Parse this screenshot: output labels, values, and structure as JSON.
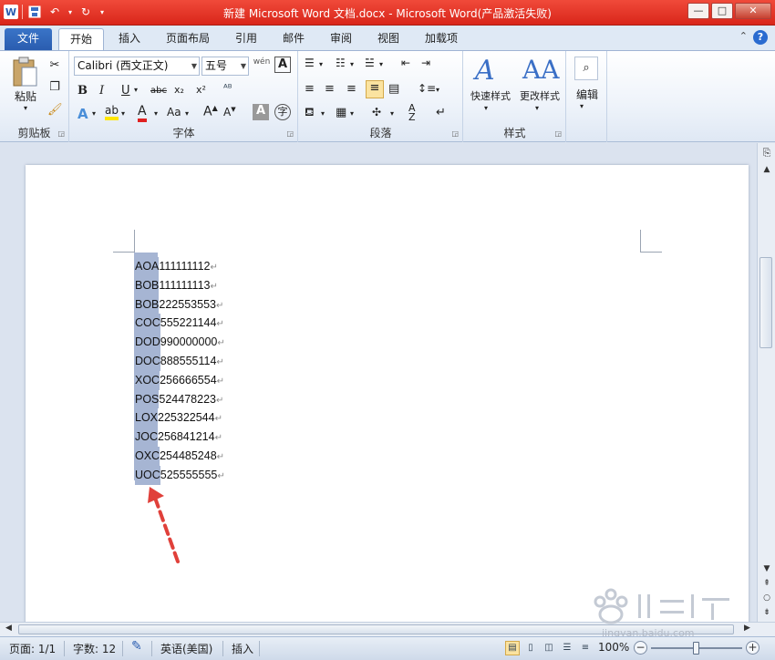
{
  "window": {
    "title": "新建 Microsoft Word 文档.docx - Microsoft Word(产品激活失败)",
    "controls": [
      "—",
      "□",
      "✕"
    ]
  },
  "qat": {
    "logo": "W",
    "save": "save-icon",
    "undo": "undo-icon",
    "redo": "redo-icon"
  },
  "tabs": [
    {
      "label": "文件"
    },
    {
      "label": "开始"
    },
    {
      "label": "插入"
    },
    {
      "label": "页面布局"
    },
    {
      "label": "引用"
    },
    {
      "label": "邮件"
    },
    {
      "label": "审阅"
    },
    {
      "label": "视图"
    },
    {
      "label": "加载项"
    }
  ],
  "ribbon": {
    "clipboard": {
      "label": "剪贴板",
      "paste": "粘贴"
    },
    "font": {
      "label": "字体",
      "name": "Calibri (西文正文)",
      "size": "五号",
      "wen": "wén"
    },
    "paragraph": {
      "label": "段落"
    },
    "styles": {
      "label": "样式",
      "quick": "快速样式",
      "change": "更改样式"
    },
    "edit": {
      "label": "编辑"
    }
  },
  "document": {
    "lines": [
      {
        "sel": "AOA",
        "rest": "111111112"
      },
      {
        "sel": "BOB",
        "rest": "111111113"
      },
      {
        "sel": "BOB",
        "rest": "222553553"
      },
      {
        "sel": "COC",
        "rest": "555221144"
      },
      {
        "sel": "DOD",
        "rest": "990000000"
      },
      {
        "sel": "DOC",
        "rest": "888555114"
      },
      {
        "sel": "XOC",
        "rest": "256666554"
      },
      {
        "sel": "POS",
        "rest": "524478223"
      },
      {
        "sel": "LOX",
        "rest": "225322544"
      },
      {
        "sel": "JOC",
        "rest": "256841214"
      },
      {
        "sel": "OXC",
        "rest": "254485248"
      },
      {
        "sel": "UOC",
        "rest": "525555555"
      }
    ],
    "para_mark": "↵"
  },
  "status": {
    "page": "页面: 1/1",
    "words": "字数: 12",
    "lang": "英语(美国)",
    "mode": "插入",
    "zoom": "100%"
  },
  "watermark": {
    "text": "jingyan.baidu.com"
  },
  "colors": {
    "title_bar": "#e23a2c",
    "file_tab": "#2a5db0",
    "selection": "#a6b5d3",
    "arrow": "#e0403a"
  }
}
